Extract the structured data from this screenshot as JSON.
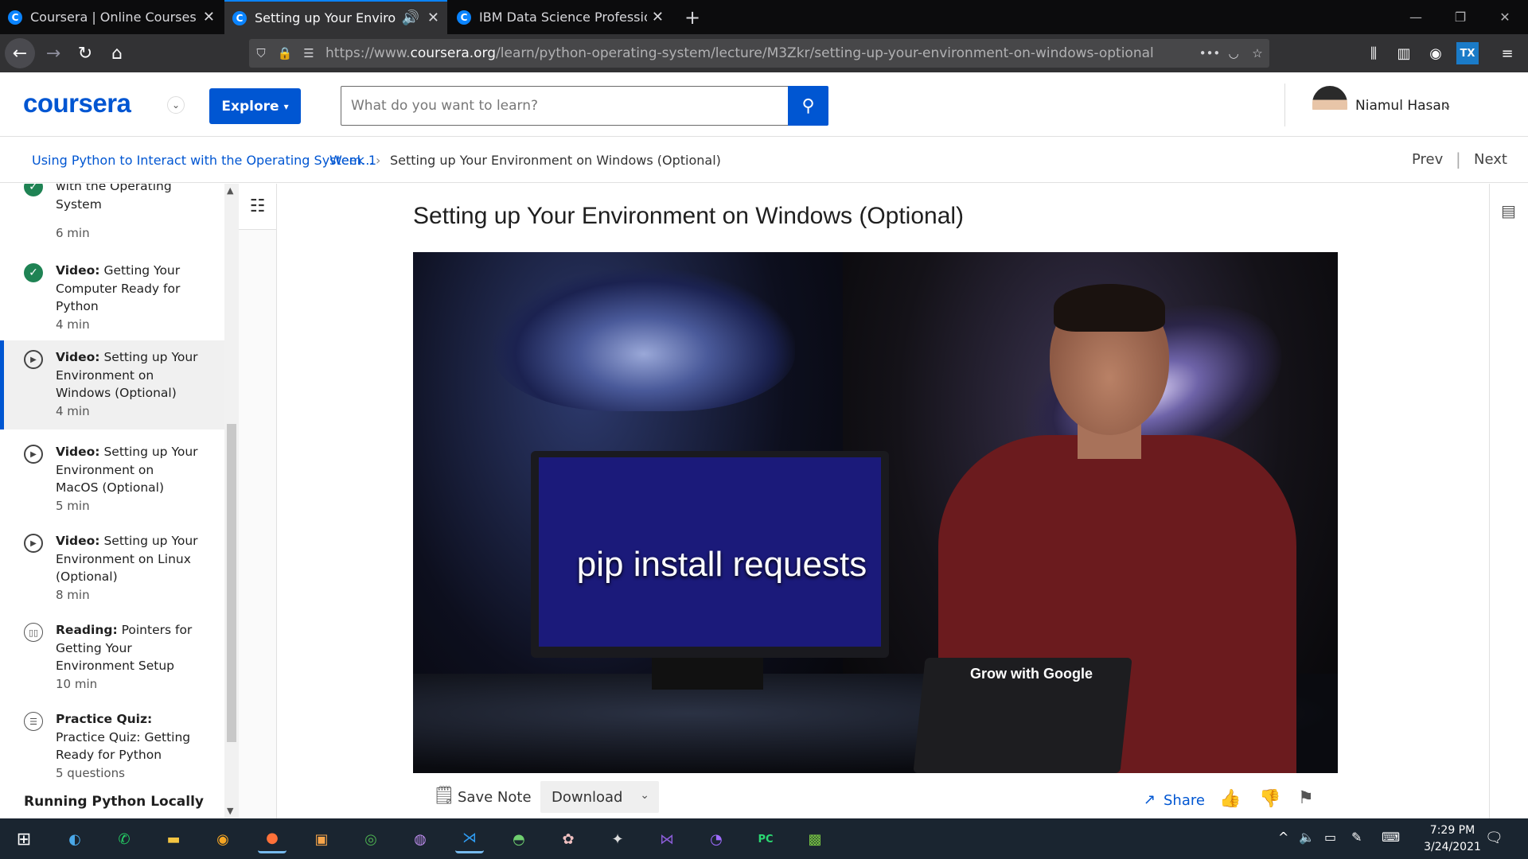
{
  "browser": {
    "tabs": [
      {
        "title": "Coursera | Online Courses & Cr",
        "favicon": "C"
      },
      {
        "title": "Setting up Your Environmen",
        "favicon": "C"
      },
      {
        "title": "IBM Data Science Professional",
        "favicon": "C"
      }
    ],
    "new_tab": "+",
    "url_prefix": "https://www.",
    "url_domain": "coursera.org",
    "url_path": "/learn/python-operating-system/lecture/M3Zkr/setting-up-your-environment-on-windows-optional"
  },
  "header": {
    "logo": "coursera",
    "explore_label": "Explore",
    "search_placeholder": "What do you want to learn?",
    "user_name": "Niamul Hasan"
  },
  "breadcrumb": {
    "course": "Using Python to Interact with the Operating System...",
    "week": "Week 1",
    "current": "Setting up Your Environment on Windows (Optional)",
    "prev": "Prev",
    "next": "Next"
  },
  "sidebar": {
    "items": [
      {
        "type": "",
        "title": "with the Operating System",
        "duration": "6 min",
        "status": "done"
      },
      {
        "type": "Video:",
        "title": "Getting Your Computer Ready for Python",
        "duration": "4 min",
        "status": "done"
      },
      {
        "type": "Video:",
        "title": "Setting up Your Environment on Windows (Optional)",
        "duration": "4 min",
        "status": "active"
      },
      {
        "type": "Video:",
        "title": "Setting up Your Environment on MacOS (Optional)",
        "duration": "5 min",
        "status": "todo"
      },
      {
        "type": "Video:",
        "title": "Setting up Your Environment on Linux (Optional)",
        "duration": "8 min",
        "status": "todo"
      },
      {
        "type": "Reading:",
        "title": "Pointers for Getting Your Environment Setup",
        "duration": "10 min",
        "status": "reading"
      },
      {
        "type": "Practice Quiz:",
        "title": "Practice Quiz: Getting Ready for Python",
        "duration": "5 questions",
        "status": "quiz"
      }
    ],
    "section_heading": "Running Python Locally"
  },
  "main": {
    "title": "Setting up Your Environment on Windows (Optional)",
    "video_caption": "pip install requests",
    "video_sticker": "Grow with Google",
    "save_note": "Save Note",
    "download": "Download",
    "share": "Share"
  },
  "taskbar": {
    "time": "7:29 PM",
    "date": "3/24/2021"
  },
  "colors": {
    "brand": "#0056d2",
    "complete": "#1f8354",
    "tab_accent": "#0a84ff"
  }
}
